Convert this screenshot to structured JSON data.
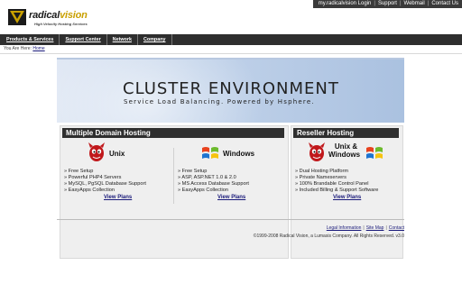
{
  "brand": {
    "name_part1": "radical",
    "name_part2": "vision",
    "tagline": "High Velocity Hosting Services"
  },
  "top_links": [
    "my.radicalvision Login",
    "Support",
    "Webmail",
    "Contact Us"
  ],
  "nav": [
    "Products & Services",
    "Support Center",
    "Network",
    "Company"
  ],
  "breadcrumb": {
    "prefix": "You Are Here:",
    "current": "Home"
  },
  "banner": {
    "title": "CLUSTER ENVIRONMENT",
    "subtitle": "Service Load Balancing. Powered by Hsphere."
  },
  "panels": {
    "multi": {
      "heading": "Multiple Domain Hosting",
      "unix": {
        "label": "Unix",
        "icon": "bsd-daemon-icon",
        "features": [
          "» Free Setup",
          "» Powerful PHP4 Servers",
          "» MySQL, PgSQL Database Support",
          "» EasyApps Collection"
        ],
        "link": "View Plans"
      },
      "windows": {
        "label": "Windows",
        "icon": "windows-logo-icon",
        "features": [
          "» Free Setup",
          "» ASP, ASP.NET 1.0 & 2.0",
          "» MS Access Database Support",
          "» EasyApps Collection"
        ],
        "link": "View Plans"
      }
    },
    "reseller": {
      "heading": "Reseller Hosting",
      "label_line1": "Unix &",
      "label_line2": "Windows",
      "features": [
        "» Dual Hosting Platform",
        "» Private Nameservers",
        "» 100% Brandable Control Panel",
        "» Included Billing & Support Software"
      ],
      "link": "View Plans"
    }
  },
  "footer": {
    "links": [
      "Legal Information",
      "Site Map",
      "Contact"
    ],
    "separator": "|",
    "copyright": "©1999-2008 Radical Vision, a Lumasis Company. All Rights Reserved. v3.0"
  },
  "colors": {
    "nav_bg": "#2e2e2e",
    "panel_head_bg": "#2f2f2f",
    "link": "#1a1a7a",
    "brand_accent": "#c9a000",
    "banner_blue": "#aac1e0"
  }
}
